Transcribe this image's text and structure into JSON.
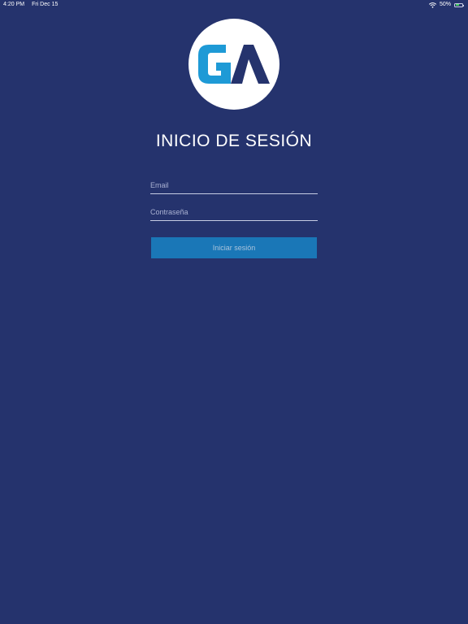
{
  "status_bar": {
    "time": "4:20 PM",
    "date": "Fri Dec 15",
    "battery": "50%",
    "battery_level": 0.5,
    "icons": [
      "wifi-icon",
      "battery-icon"
    ]
  },
  "logo": {
    "letters": "GA",
    "colors": {
      "background": "#ffffff",
      "primary": "#1e9ad6",
      "secondary": "#25336d"
    }
  },
  "title": "INICIO DE SESIÓN",
  "form": {
    "email_placeholder": "Email",
    "password_placeholder": "Contraseña",
    "submit_label": "Iniciar sesión"
  },
  "colors": {
    "background": "#25336d",
    "button": "#1a77b7"
  }
}
